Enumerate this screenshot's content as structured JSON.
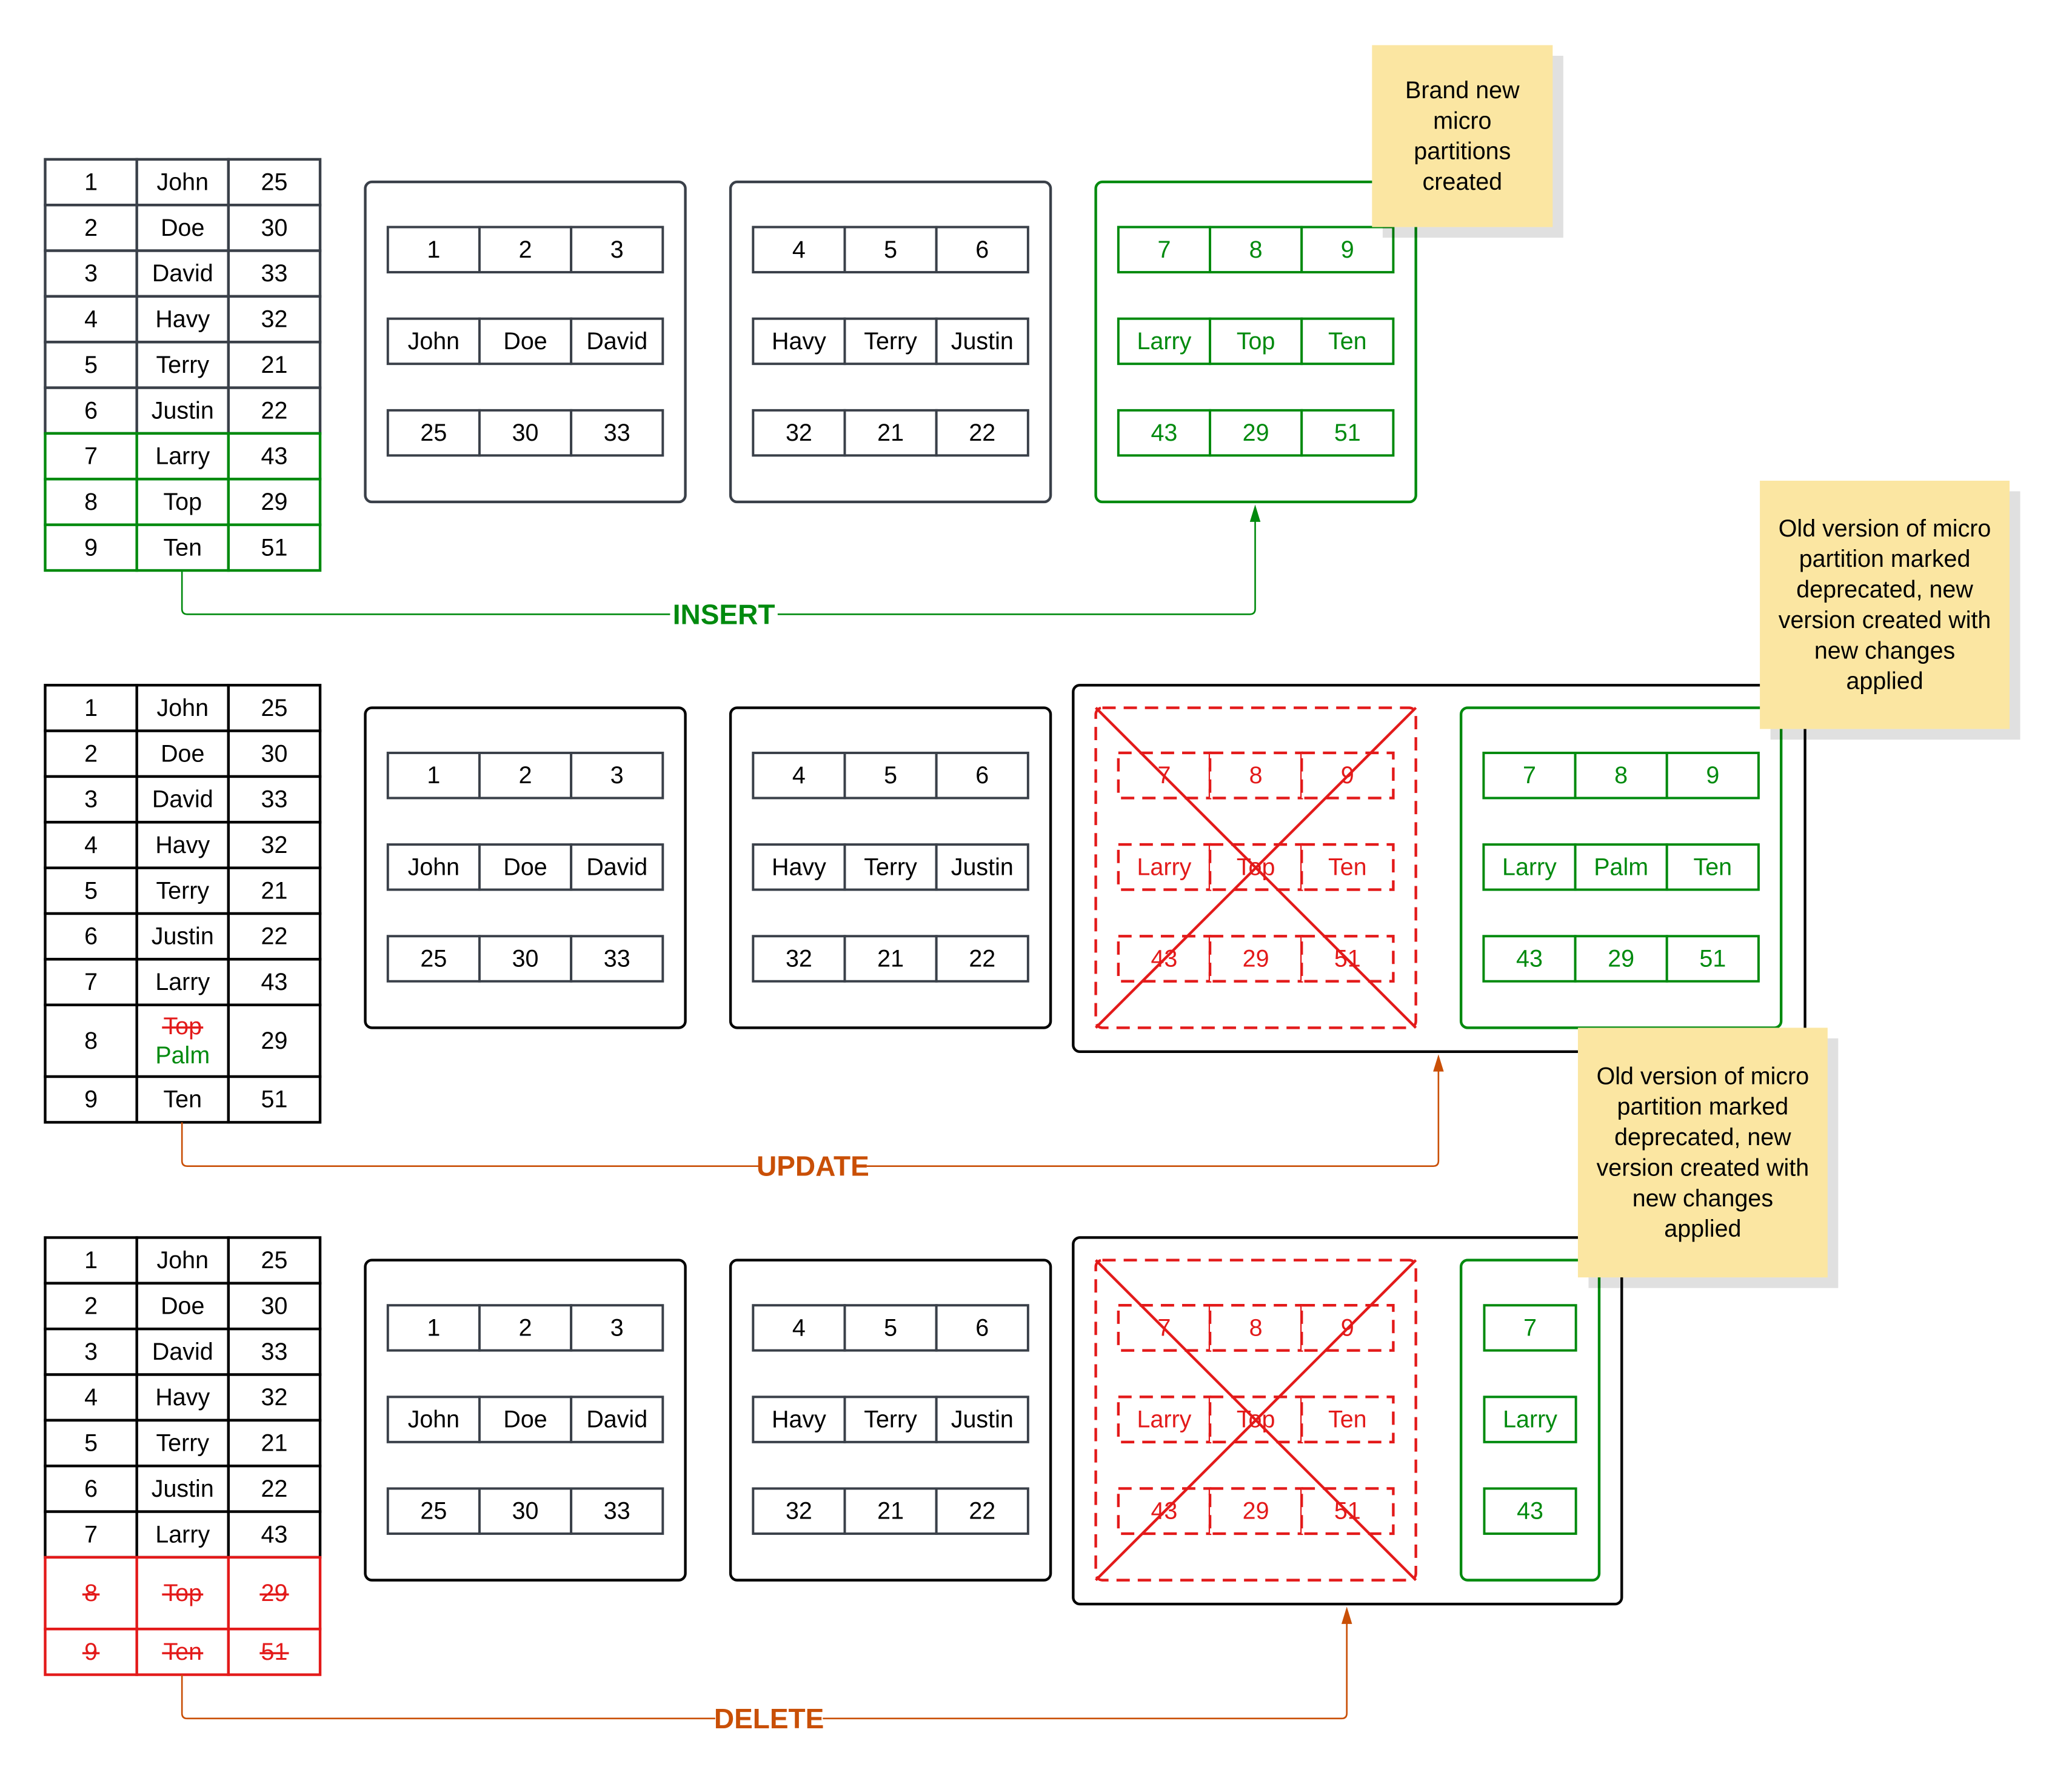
{
  "colors": {
    "dark": "#3a4049",
    "black": "#000000",
    "green": "#008a0e",
    "red": "#e31a1a",
    "orange": "#c94f06",
    "sticky": "#fbe6a2"
  },
  "sections": [
    {
      "operation": "INSERT",
      "color_key": "green",
      "table": [
        {
          "cells": [
            "1",
            "John",
            "25"
          ],
          "state": "normal"
        },
        {
          "cells": [
            "2",
            "Doe",
            "30"
          ],
          "state": "normal"
        },
        {
          "cells": [
            "3",
            "David",
            "33"
          ],
          "state": "normal"
        },
        {
          "cells": [
            "4",
            "Havy",
            "32"
          ],
          "state": "normal"
        },
        {
          "cells": [
            "5",
            "Terry",
            "21"
          ],
          "state": "normal"
        },
        {
          "cells": [
            "6",
            "Justin",
            "22"
          ],
          "state": "normal"
        },
        {
          "cells": [
            "7",
            "Larry",
            "43"
          ],
          "state": "inserted"
        },
        {
          "cells": [
            "8",
            "Top",
            "29"
          ],
          "state": "inserted"
        },
        {
          "cells": [
            "9",
            "Ten",
            "51"
          ],
          "state": "inserted"
        }
      ],
      "partitions": [
        {
          "state": "normal",
          "columns": [
            [
              "1",
              "2",
              "3"
            ],
            [
              "John",
              "Doe",
              "David"
            ],
            [
              "25",
              "30",
              "33"
            ]
          ]
        },
        {
          "state": "normal",
          "columns": [
            [
              "4",
              "5",
              "6"
            ],
            [
              "Havy",
              "Terry",
              "Justin"
            ],
            [
              "32",
              "21",
              "22"
            ]
          ]
        },
        {
          "state": "new",
          "columns": [
            [
              "7",
              "8",
              "9"
            ],
            [
              "Larry",
              "Top",
              "Ten"
            ],
            [
              "43",
              "29",
              "51"
            ]
          ]
        }
      ],
      "note": "Brand new micro partitions created"
    },
    {
      "operation": "UPDATE",
      "color_key": "orange",
      "table": [
        {
          "cells": [
            "1",
            "John",
            "25"
          ],
          "state": "normal"
        },
        {
          "cells": [
            "2",
            "Doe",
            "30"
          ],
          "state": "normal"
        },
        {
          "cells": [
            "3",
            "David",
            "33"
          ],
          "state": "normal"
        },
        {
          "cells": [
            "4",
            "Havy",
            "32"
          ],
          "state": "normal"
        },
        {
          "cells": [
            "5",
            "Terry",
            "21"
          ],
          "state": "normal"
        },
        {
          "cells": [
            "6",
            "Justin",
            "22"
          ],
          "state": "normal"
        },
        {
          "cells": [
            "7",
            "Larry",
            "43"
          ],
          "state": "normal"
        },
        {
          "cells": [
            "8",
            "Top",
            "29"
          ],
          "state": "updated",
          "new_value": "Palm"
        },
        {
          "cells": [
            "9",
            "Ten",
            "51"
          ],
          "state": "normal"
        }
      ],
      "partitions": [
        {
          "state": "normal",
          "columns": [
            [
              "1",
              "2",
              "3"
            ],
            [
              "John",
              "Doe",
              "David"
            ],
            [
              "25",
              "30",
              "33"
            ]
          ]
        },
        {
          "state": "normal",
          "columns": [
            [
              "4",
              "5",
              "6"
            ],
            [
              "Havy",
              "Terry",
              "Justin"
            ],
            [
              "32",
              "21",
              "22"
            ]
          ]
        },
        {
          "state": "deprecated",
          "columns": [
            [
              "7",
              "8",
              "9"
            ],
            [
              "Larry",
              "Top",
              "Ten"
            ],
            [
              "43",
              "29",
              "51"
            ]
          ]
        },
        {
          "state": "new",
          "columns": [
            [
              "7",
              "8",
              "9"
            ],
            [
              "Larry",
              "Palm",
              "Ten"
            ],
            [
              "43",
              "29",
              "51"
            ]
          ]
        }
      ],
      "note": "Old version of micro partition marked deprecated, new version created with new changes applied"
    },
    {
      "operation": "DELETE",
      "color_key": "orange",
      "table": [
        {
          "cells": [
            "1",
            "John",
            "25"
          ],
          "state": "normal"
        },
        {
          "cells": [
            "2",
            "Doe",
            "30"
          ],
          "state": "normal"
        },
        {
          "cells": [
            "3",
            "David",
            "33"
          ],
          "state": "normal"
        },
        {
          "cells": [
            "4",
            "Havy",
            "32"
          ],
          "state": "normal"
        },
        {
          "cells": [
            "5",
            "Terry",
            "21"
          ],
          "state": "normal"
        },
        {
          "cells": [
            "6",
            "Justin",
            "22"
          ],
          "state": "normal"
        },
        {
          "cells": [
            "7",
            "Larry",
            "43"
          ],
          "state": "normal"
        },
        {
          "cells": [
            "8",
            "Top",
            "29"
          ],
          "state": "deleted"
        },
        {
          "cells": [
            "9",
            "Ten",
            "51"
          ],
          "state": "deleted"
        }
      ],
      "partitions": [
        {
          "state": "normal",
          "columns": [
            [
              "1",
              "2",
              "3"
            ],
            [
              "John",
              "Doe",
              "David"
            ],
            [
              "25",
              "30",
              "33"
            ]
          ]
        },
        {
          "state": "normal",
          "columns": [
            [
              "4",
              "5",
              "6"
            ],
            [
              "Havy",
              "Terry",
              "Justin"
            ],
            [
              "32",
              "21",
              "22"
            ]
          ]
        },
        {
          "state": "deprecated",
          "columns": [
            [
              "7",
              "8",
              "9"
            ],
            [
              "Larry",
              "Top",
              "Ten"
            ],
            [
              "43",
              "29",
              "51"
            ]
          ]
        },
        {
          "state": "new",
          "columns": [
            [
              "7"
            ],
            [
              "Larry"
            ],
            [
              "43"
            ]
          ]
        }
      ],
      "note": "Old version of micro partition marked deprecated, new version created with new changes applied"
    }
  ]
}
